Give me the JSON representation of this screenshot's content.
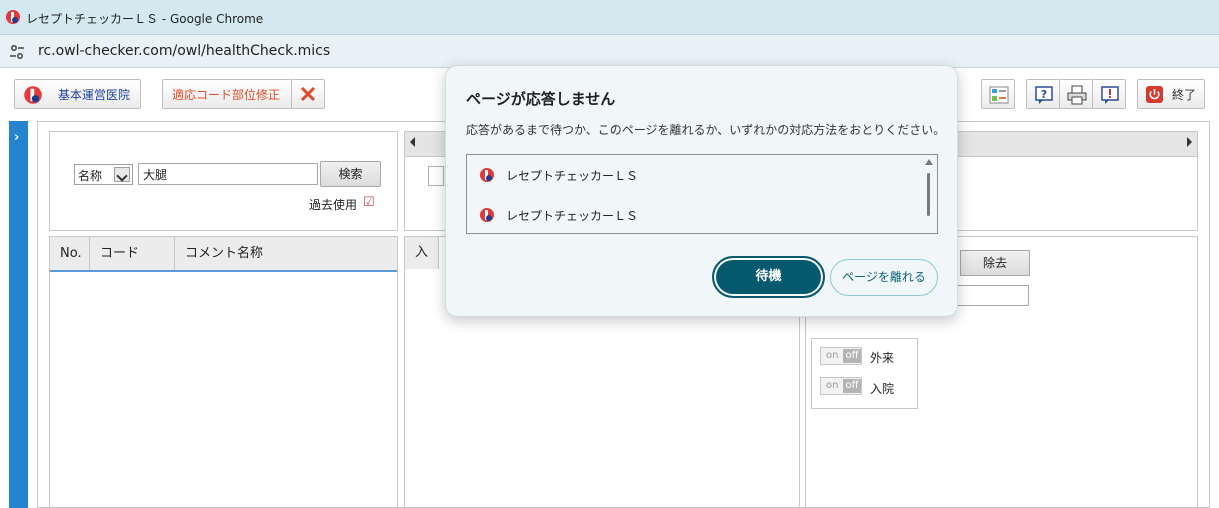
{
  "browser": {
    "window_title": "レセプトチェッカーＬＳ - Google Chrome",
    "url": "rc.owl-checker.com/owl/healthCheck.mics"
  },
  "toolbar": {
    "clinic_label": "基本運営医院",
    "fix_label": "適応コード部位修正",
    "exit_label": "終了"
  },
  "search": {
    "field_selected": "名称",
    "keyword_value": "大腿",
    "search_button": "検索",
    "past_use_label": "過去使用",
    "past_use_checked": true
  },
  "comment_table": {
    "columns": [
      "No.",
      "コード",
      "コメント名称"
    ],
    "rows": []
  },
  "middle": {
    "header_cell": "入"
  },
  "right_panel": {
    "remove_button": "除去",
    "toggles": [
      {
        "on": "on",
        "off": "off",
        "label": "外来",
        "state": "off"
      },
      {
        "on": "on",
        "off": "off",
        "label": "入院",
        "state": "off"
      }
    ]
  },
  "dialog": {
    "title": "ページが応答しません",
    "message": "応答があるまで待つか、このページを離れるか、いずれかの対応方法をおとりください。",
    "pages": [
      "レセプトチェッカーＬＳ",
      "レセプトチェッカーＬＳ"
    ],
    "wait_button": "待機",
    "leave_button": "ページを離れる"
  },
  "colors": {
    "accent_teal": "#075a6d",
    "sidebar_blue": "#2584d0",
    "fix_red": "#e04a2a"
  }
}
